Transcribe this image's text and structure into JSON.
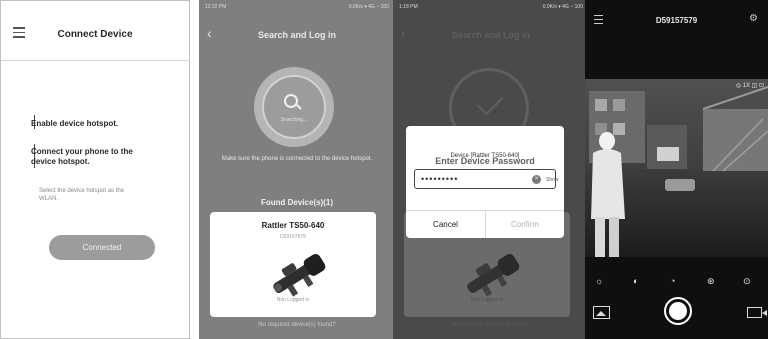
{
  "screen1": {
    "title": "Connect Device",
    "step1": "Enable device hotspot.",
    "step2_line1": "Connect your phone to the",
    "step2_line2": "device hotspot.",
    "hint_line1": "Select the device hotspot as the",
    "hint_line2": "WLAN.",
    "button": "Connected"
  },
  "screen2": {
    "status_time": "12:22 PM",
    "status_right": "0.0K/s ▾ 4G ◔ 100",
    "title": "Search and Log in",
    "searching": "Searching...",
    "tip": "Make sure the phone is connected to the device hotspot.",
    "found": "Found Device(s)(1)",
    "device_name": "Rattler TS50-640",
    "device_serial": "D59157579",
    "device_caption": "Non Logged in",
    "bottom_link": "No required device(s) found?"
  },
  "screen3": {
    "status_time": "1:18 PM",
    "status_right": "0.0K/s ▾ 4G ◔ 100",
    "title": "Search and Log in",
    "dialog_title": "Enter Device Password",
    "dialog_device": "Device [Rattler TS50-640]",
    "password_mask": "•••••••••",
    "eye_label": "Show",
    "cancel": "Cancel",
    "confirm": "Confirm",
    "card_caption": "Non Logged in",
    "bottom_link": "No required device(s) found?"
  },
  "screen4": {
    "title": "D59157579",
    "overlay": "◎ 1X ◫ ⊡",
    "controls": [
      "☼",
      "◐",
      "◔",
      "⊛",
      "⊙"
    ]
  },
  "colors": {
    "accent_gray": "#9c9c9c",
    "dark_bg": "#0f0f0f"
  }
}
